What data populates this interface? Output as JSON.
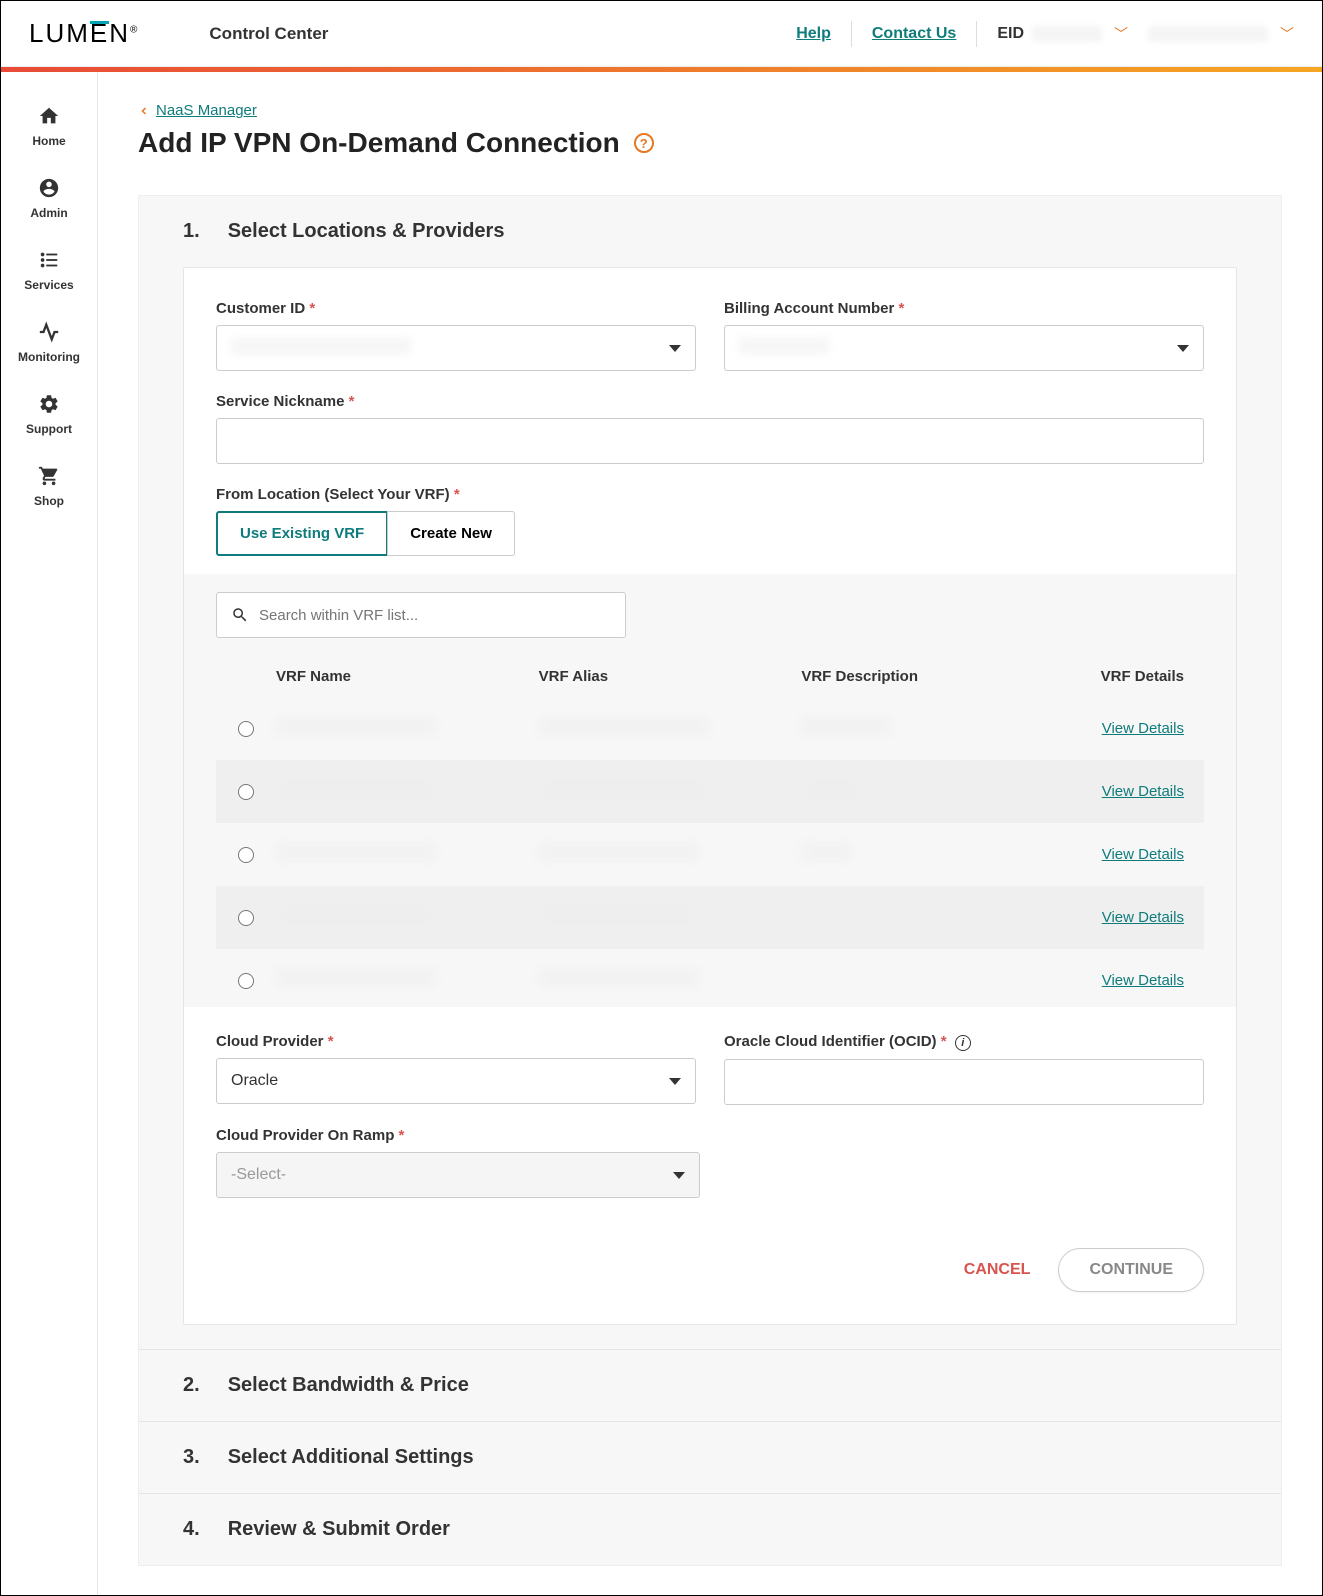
{
  "header": {
    "logo_text": "LUMEN",
    "app_title": "Control Center",
    "help_link": "Help",
    "contact_link": "Contact Us",
    "eid_label": "EID"
  },
  "sidebar": {
    "items": [
      {
        "label": "Home",
        "icon": "home-icon"
      },
      {
        "label": "Admin",
        "icon": "user-circle-icon"
      },
      {
        "label": "Services",
        "icon": "list-icon"
      },
      {
        "label": "Monitoring",
        "icon": "activity-icon"
      },
      {
        "label": "Support",
        "icon": "gear-icon"
      },
      {
        "label": "Shop",
        "icon": "cart-icon"
      }
    ]
  },
  "breadcrumb": {
    "back_label": "NaaS Manager"
  },
  "page": {
    "title": "Add IP VPN On-Demand Connection"
  },
  "wizard": {
    "steps": [
      {
        "num": "1.",
        "title": "Select Locations & Providers"
      },
      {
        "num": "2.",
        "title": "Select Bandwidth & Price"
      },
      {
        "num": "3.",
        "title": "Select Additional Settings"
      },
      {
        "num": "4.",
        "title": "Review & Submit Order"
      }
    ]
  },
  "form": {
    "customer_id_label": "Customer ID",
    "billing_label": "Billing Account Number",
    "nickname_label": "Service Nickname",
    "from_location_label": "From Location (Select Your VRF)",
    "toggle_existing": "Use Existing VRF",
    "toggle_create": "Create New",
    "search_placeholder": "Search within VRF list...",
    "cloud_provider_label": "Cloud Provider",
    "cloud_provider_value": "Oracle",
    "ocid_label": "Oracle Cloud Identifier (OCID)",
    "onramp_label": "Cloud Provider On Ramp",
    "onramp_value": "-Select-",
    "cancel": "CANCEL",
    "continue": "CONTINUE"
  },
  "vrf_table": {
    "headers": {
      "name": "VRF Name",
      "alias": "VRF Alias",
      "description": "VRF Description",
      "details": "VRF Details"
    },
    "view_details": "View Details",
    "rows": 5
  }
}
